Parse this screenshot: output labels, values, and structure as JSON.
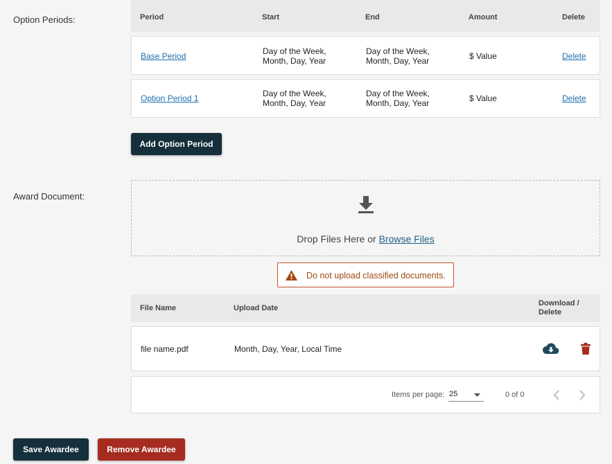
{
  "option_periods": {
    "label": "Option Periods:",
    "headers": {
      "period": "Period",
      "start": "Start",
      "end": "End",
      "amount": "Amount",
      "delete": "Delete"
    },
    "rows": [
      {
        "period": "Base Period",
        "start_l1": "Day of the Week,",
        "start_l2": "Month, Day, Year",
        "end_l1": "Day of the Week,",
        "end_l2": "Month, Day, Year",
        "amount": "$ Value",
        "delete": "Delete"
      },
      {
        "period": "Option Period 1",
        "start_l1": "Day of the Week,",
        "start_l2": "Month, Day, Year",
        "end_l1": "Day of the Week,",
        "end_l2": "Month, Day, Year",
        "amount": "$ Value",
        "delete": "Delete"
      }
    ],
    "add_button": "Add Option Period"
  },
  "award_document": {
    "label": "Award Document:",
    "drop_text": "Drop Files Here or",
    "browse_link": "Browse Files",
    "warning": "Do not upload classified documents.",
    "headers": {
      "file_name": "File Name",
      "upload_date": "Upload Date",
      "download_delete_l1": "Download /",
      "download_delete_l2": "Delete"
    },
    "files": [
      {
        "name": "file name.pdf",
        "date": "Month, Day, Year, Local Time",
        "download_icon": "cloud-download-icon",
        "delete_icon": "trash-icon"
      }
    ],
    "pagination": {
      "items_per_page_label": "Items per page:",
      "items_per_page": "25",
      "range": "0 of 0"
    }
  },
  "footer": {
    "save": "Save Awardee",
    "remove": "Remove Awardee"
  },
  "colors": {
    "primary": "#152f3b",
    "danger": "#a52c1f",
    "link": "#1f6fae",
    "warning": "#c0522a"
  }
}
